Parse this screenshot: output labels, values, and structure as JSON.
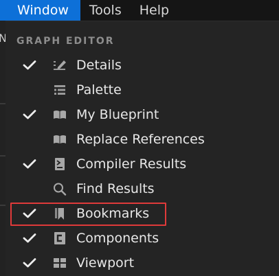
{
  "menubar": {
    "items": [
      {
        "label": "Window",
        "active": true
      },
      {
        "label": "Tools",
        "active": false
      },
      {
        "label": "Help",
        "active": false
      }
    ]
  },
  "backdrop": {
    "partial_text": "N"
  },
  "dropdown": {
    "section_title": "GRAPH EDITOR",
    "items": [
      {
        "label": "Details",
        "checked": true,
        "icon": "details-pencil-icon"
      },
      {
        "label": "Palette",
        "checked": false,
        "icon": "palette-list-icon"
      },
      {
        "label": "My Blueprint",
        "checked": true,
        "icon": "book-icon"
      },
      {
        "label": "Replace References",
        "checked": false,
        "icon": "book-icon"
      },
      {
        "label": "Compiler Results",
        "checked": true,
        "icon": "compiler-results-icon"
      },
      {
        "label": "Find Results",
        "checked": false,
        "icon": "search-icon"
      },
      {
        "label": "Bookmarks",
        "checked": true,
        "icon": "bookmark-icon",
        "highlighted": true
      },
      {
        "label": "Components",
        "checked": true,
        "icon": "components-icon"
      },
      {
        "label": "Viewport",
        "checked": true,
        "icon": "viewport-icon"
      }
    ]
  },
  "colors": {
    "accent": "#0d70d8",
    "highlight_border": "#e03a3a",
    "panel_bg": "#242424"
  }
}
